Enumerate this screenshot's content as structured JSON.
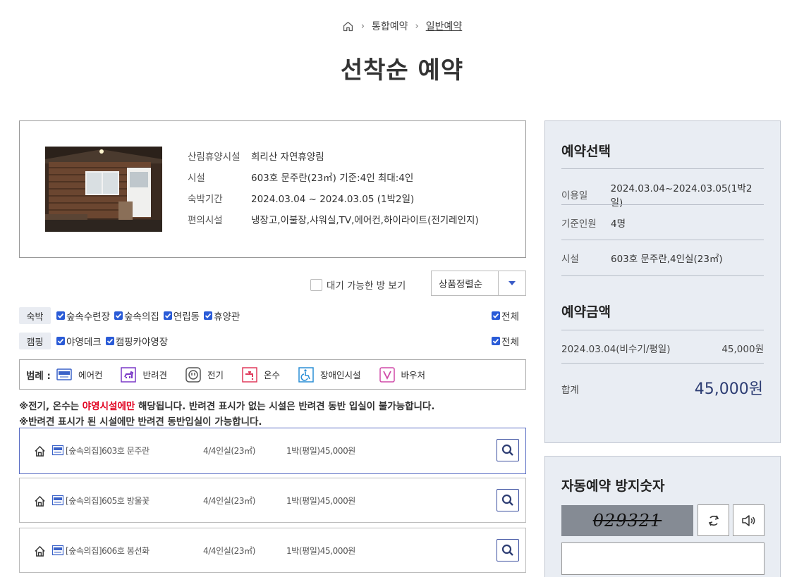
{
  "breadcrumb": {
    "items": [
      "통합예약",
      "일반예약"
    ]
  },
  "page_title": "선착순 예약",
  "facility": {
    "rows": [
      {
        "key": "산림휴양시설",
        "value": "희리산 자연휴양림"
      },
      {
        "key": "시설",
        "value": "603호 문주란(23㎡) 기준:4인 최대:4인"
      },
      {
        "key": "숙박기간",
        "value": "2024.03.04 ~ 2024.03.05 (1박2일)"
      },
      {
        "key": "편의시설",
        "value": "냉장고,이불장,샤워실,TV,에어컨,하이라이트(전기레인지)"
      }
    ]
  },
  "filters": {
    "wait_label": "대기 가능한 방 보기",
    "sort_label": "상품정렬순"
  },
  "categories": {
    "lodging": {
      "tag": "숙박",
      "options": [
        "숲속수련장",
        "숲속의집",
        "연립동",
        "휴양관"
      ],
      "all": "전체"
    },
    "camping": {
      "tag": "캠핑",
      "options": [
        "야영데크",
        "캠핑카야영장"
      ],
      "all": "전체"
    }
  },
  "legend": {
    "title": "범례 :",
    "items": [
      "에어컨",
      "반려견",
      "전기",
      "온수",
      "장애인시설",
      "바우처"
    ],
    "colors": {
      "aircon": "#3a62c8",
      "pet": "#7a39c7",
      "electric": "#555555",
      "hotwater": "#e03a5c",
      "disabled": "#2b8fd6",
      "voucher": "#d04aa8"
    }
  },
  "notices": {
    "line1_pre": "※전기, 온수는 ",
    "line1_red": "야영시설에만",
    "line1_post": " 해당됩니다. 반려견 표시가 없는 시설은 반려견 동반 입실이 불가능합니다.",
    "line2": "※반려견 표시가 된 시설에만 반려견 동반입실이 가능합니다."
  },
  "rooms": [
    {
      "name": "[숲속의집]603호 문주란",
      "capacity": "4/4인실(23㎡)",
      "price": "1박(평일)45,000원"
    },
    {
      "name": "[숲속의집]605호 방울꽃",
      "capacity": "4/4인실(23㎡)",
      "price": "1박(평일)45,000원"
    },
    {
      "name": "[숲속의집]606호 봉선화",
      "capacity": "4/4인실(23㎡)",
      "price": "1박(평일)45,000원"
    }
  ],
  "summary": {
    "title": "예약선택",
    "rows": [
      {
        "key": "이용일",
        "value": "2024.03.04~2024.03.05(1박2일)"
      },
      {
        "key": "기준인원",
        "value": "4명"
      },
      {
        "key": "시설",
        "value": "603호 문주란,4인실(23㎡)"
      }
    ],
    "price_title": "예약금액",
    "price_line": {
      "date": "2024.03.04(비수기/평일)",
      "amount": "45,000원"
    },
    "total_label": "합계",
    "total_value": "45,000원"
  },
  "captcha": {
    "title": "자동예약 방지숫자",
    "code": "029321"
  },
  "colors": {
    "accent": "#2d3d73",
    "checkbox": "#2a5bd7",
    "red_notice": "#e1001f",
    "panel_bg": "#e9edf3"
  }
}
